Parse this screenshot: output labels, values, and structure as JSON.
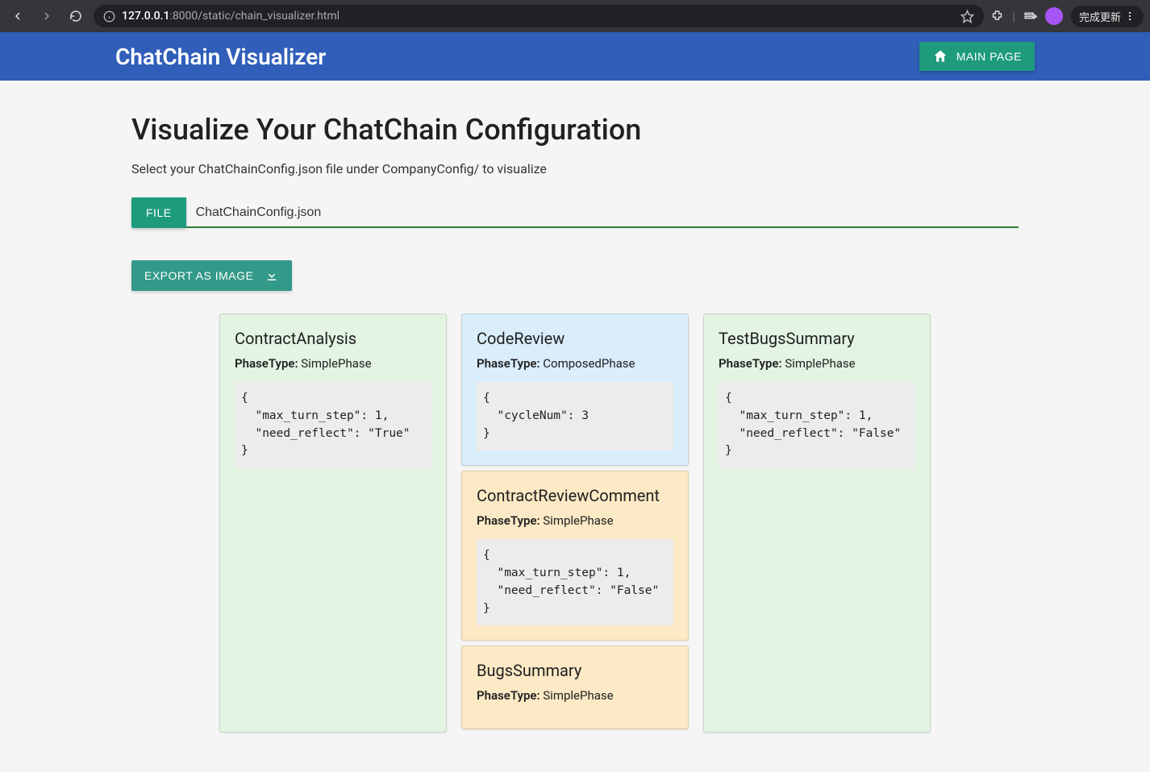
{
  "browser": {
    "url_host": "127.0.0.1",
    "url_path": ":8000/static/chain_visualizer.html",
    "update_label": "完成更新",
    "avatar_letter": ""
  },
  "header": {
    "brand": "ChatChain Visualizer",
    "main_page_label": "MAIN PAGE"
  },
  "page": {
    "title": "Visualize Your ChatChain Configuration",
    "subtitle": "Select your ChatChainConfig.json file under CompanyConfig/ to visualize",
    "file_button_label": "FILE",
    "file_name": "ChatChainConfig.json",
    "export_label": "EXPORT AS IMAGE"
  },
  "labels": {
    "phase_type_prefix": "PhaseType:"
  },
  "columns": [
    {
      "cards": [
        {
          "title": "ContractAnalysis",
          "phase_type": "SimplePhase",
          "style": "simple",
          "code": "{\n  \"max_turn_step\": 1,\n  \"need_reflect\": \"True\"\n}"
        }
      ]
    },
    {
      "cards": [
        {
          "title": "CodeReview",
          "phase_type": "ComposedPhase",
          "style": "composed",
          "code": "{\n  \"cycleNum\": 3\n}"
        },
        {
          "title": "ContractReviewComment",
          "phase_type": "SimplePhase",
          "style": "sub",
          "code": "{\n  \"max_turn_step\": 1,\n  \"need_reflect\": \"False\"\n}"
        },
        {
          "title": "BugsSummary",
          "phase_type": "SimplePhase",
          "style": "sub",
          "code": ""
        }
      ]
    },
    {
      "cards": [
        {
          "title": "TestBugsSummary",
          "phase_type": "SimplePhase",
          "style": "simple",
          "code": "{\n  \"max_turn_step\": 1,\n  \"need_reflect\": \"False\"\n}"
        }
      ]
    }
  ]
}
